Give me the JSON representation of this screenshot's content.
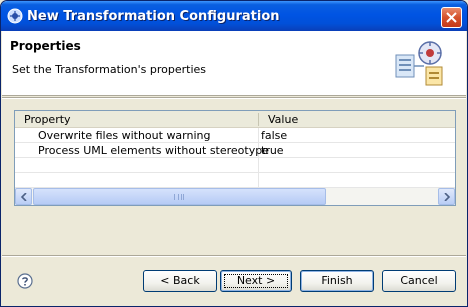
{
  "window": {
    "title": "New Transformation Configuration",
    "title_icon": "eclipse-app-icon",
    "close_icon": "close-icon"
  },
  "header": {
    "title": "Properties",
    "description": "Set the Transformation's properties",
    "image": "wizard-banner-icon"
  },
  "table": {
    "columns": [
      "Property",
      "Value"
    ],
    "rows": [
      {
        "property": "Overwrite files without warning",
        "value": "false"
      },
      {
        "property": "Process UML elements without stereotype",
        "value": "true"
      }
    ]
  },
  "buttons": {
    "back": "< Back",
    "next": "Next >",
    "finish": "Finish",
    "cancel": "Cancel",
    "help_icon": "help-icon"
  },
  "colors": {
    "titlebar": "#0054e3",
    "dialog_bg": "#ece9d8",
    "button_border": "#003c74"
  }
}
